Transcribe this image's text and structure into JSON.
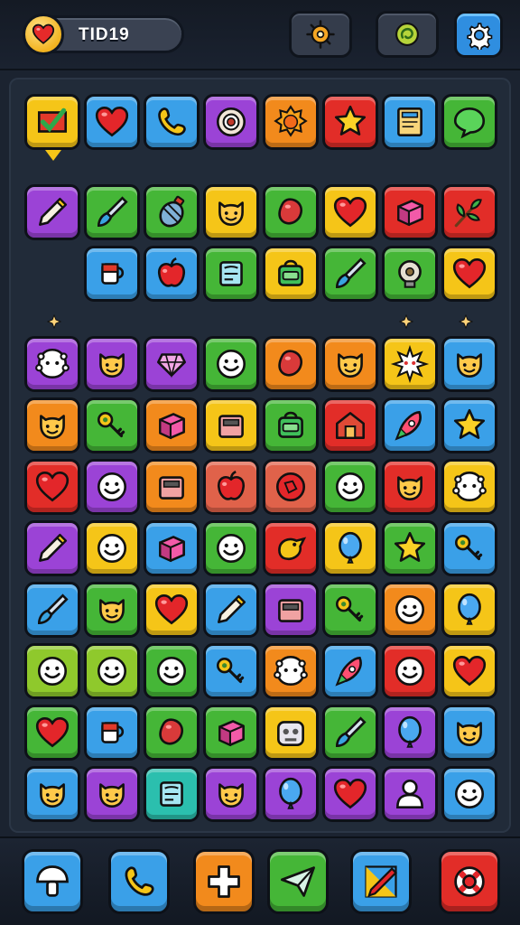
{
  "header": {
    "lives_value": "TID19",
    "buttons": [
      {
        "name": "daily-bonus-button",
        "icon": "sun-gear-icon"
      },
      {
        "name": "hint-button",
        "icon": "swirl-icon"
      },
      {
        "name": "settings-button",
        "icon": "gear-icon"
      }
    ]
  },
  "palette": {
    "yellow": "#f5c518",
    "blue": "#3aa0e8",
    "purple": "#9b43d6",
    "orange": "#f28a1c",
    "red": "#e22d28",
    "green": "#45b637",
    "lime": "#8fc92c",
    "teal": "#2bbfae",
    "salmon": "#e0624a",
    "icon_dark": "#1a1a1a"
  },
  "board": {
    "top_row": [
      {
        "color": "yellow",
        "icon": "check-flag-icon"
      },
      {
        "color": "blue",
        "icon": "heart-icon"
      },
      {
        "color": "blue",
        "icon": "phone-icon"
      },
      {
        "color": "purple",
        "icon": "target-icon"
      },
      {
        "color": "orange",
        "icon": "sun-icon"
      },
      {
        "color": "red",
        "icon": "star-icon"
      },
      {
        "color": "blue",
        "icon": "book-icon"
      },
      {
        "color": "green",
        "icon": "speech-bubble-icon"
      }
    ],
    "row_two": [
      {
        "color": "purple",
        "icon": "pencil-icon"
      },
      {
        "color": "green",
        "icon": "brush-icon"
      },
      {
        "color": "green",
        "icon": "grenade-icon"
      },
      {
        "color": "yellow",
        "icon": "cat-face-icon"
      },
      {
        "color": "green",
        "icon": "bean-icon"
      },
      {
        "color": "yellow",
        "icon": "heart-icon"
      },
      {
        "color": "red",
        "icon": "cube-icon"
      },
      {
        "color": "red",
        "icon": "leaf-branch-icon"
      }
    ],
    "row_three": [
      {
        "color": "blue",
        "icon": "mug-icon"
      },
      {
        "color": "blue",
        "icon": "apple-icon"
      },
      {
        "color": "green",
        "icon": "scroll-icon"
      },
      {
        "color": "yellow",
        "icon": "bag-icon"
      },
      {
        "color": "green",
        "icon": "brush-icon"
      },
      {
        "color": "green",
        "icon": "bulb-icon"
      },
      {
        "color": "yellow",
        "icon": "heart-icon"
      }
    ],
    "grid": [
      [
        {
          "color": "purple",
          "icon": "ghost-icon"
        },
        {
          "color": "purple",
          "icon": "cat-face-icon"
        },
        {
          "color": "purple",
          "icon": "gem-icon"
        },
        {
          "color": "green",
          "icon": "smiley-icon"
        },
        {
          "color": "orange",
          "icon": "bean-icon"
        },
        {
          "color": "orange",
          "icon": "cat-face-icon"
        },
        {
          "color": "yellow",
          "icon": "burst-icon"
        },
        {
          "color": "blue",
          "icon": "cat-face-icon"
        }
      ],
      [
        {
          "color": "orange",
          "icon": "cat-face-icon"
        },
        {
          "color": "green",
          "icon": "key-icon"
        },
        {
          "color": "orange",
          "icon": "cube-icon"
        },
        {
          "color": "yellow",
          "icon": "box-icon"
        },
        {
          "color": "green",
          "icon": "bag-icon"
        },
        {
          "color": "red",
          "icon": "house-icon"
        },
        {
          "color": "blue",
          "icon": "rocket-icon"
        },
        {
          "color": "blue",
          "icon": "star-icon"
        }
      ],
      [
        {
          "color": "red",
          "icon": "heart-icon"
        },
        {
          "color": "purple",
          "icon": "smiley-icon"
        },
        {
          "color": "orange",
          "icon": "box-icon"
        },
        {
          "color": "salmon",
          "icon": "apple-icon"
        },
        {
          "color": "salmon",
          "icon": "ball-icon"
        },
        {
          "color": "green",
          "icon": "smiley-icon"
        },
        {
          "color": "red",
          "icon": "cat-face-icon"
        },
        {
          "color": "yellow",
          "icon": "ghost-icon"
        }
      ],
      [
        {
          "color": "purple",
          "icon": "pencil-icon"
        },
        {
          "color": "yellow",
          "icon": "smiley-icon"
        },
        {
          "color": "blue",
          "icon": "cube-icon"
        },
        {
          "color": "green",
          "icon": "smiley-icon"
        },
        {
          "color": "red",
          "icon": "bird-icon"
        },
        {
          "color": "yellow",
          "icon": "balloon-icon"
        },
        {
          "color": "green",
          "icon": "star-icon"
        },
        {
          "color": "blue",
          "icon": "key-icon"
        }
      ],
      [
        {
          "color": "blue",
          "icon": "brush-icon"
        },
        {
          "color": "green",
          "icon": "cat-face-icon"
        },
        {
          "color": "yellow",
          "icon": "heart-icon"
        },
        {
          "color": "blue",
          "icon": "pencil-icon"
        },
        {
          "color": "purple",
          "icon": "box-icon"
        },
        {
          "color": "green",
          "icon": "key-icon"
        },
        {
          "color": "orange",
          "icon": "smiley-icon"
        },
        {
          "color": "yellow",
          "icon": "balloon-icon"
        }
      ],
      [
        {
          "color": "lime",
          "icon": "smiley-icon"
        },
        {
          "color": "lime",
          "icon": "smiley-icon"
        },
        {
          "color": "green",
          "icon": "smiley-icon"
        },
        {
          "color": "blue",
          "icon": "key-icon"
        },
        {
          "color": "orange",
          "icon": "ghost-icon"
        },
        {
          "color": "blue",
          "icon": "rocket-icon"
        },
        {
          "color": "red",
          "icon": "smiley-icon"
        },
        {
          "color": "yellow",
          "icon": "heart-icon"
        }
      ],
      [
        {
          "color": "green",
          "icon": "heart-icon"
        },
        {
          "color": "blue",
          "icon": "mug-icon"
        },
        {
          "color": "green",
          "icon": "bean-icon"
        },
        {
          "color": "green",
          "icon": "cube-icon"
        },
        {
          "color": "yellow",
          "icon": "robot-icon"
        },
        {
          "color": "green",
          "icon": "brush-icon"
        },
        {
          "color": "purple",
          "icon": "balloon-icon"
        },
        {
          "color": "blue",
          "icon": "cat-face-icon"
        }
      ],
      [
        {
          "color": "blue",
          "icon": "cat-face-icon"
        },
        {
          "color": "purple",
          "icon": "cat-face-icon"
        },
        {
          "color": "teal",
          "icon": "scroll-icon"
        },
        {
          "color": "purple",
          "icon": "cat-face-icon"
        },
        {
          "color": "purple",
          "icon": "balloon-icon"
        },
        {
          "color": "purple",
          "icon": "heart-icon"
        },
        {
          "color": "purple",
          "icon": "person-icon"
        },
        {
          "color": "blue",
          "icon": "smiley-icon"
        }
      ]
    ]
  },
  "bottom_bar": [
    {
      "name": "mushroom-button",
      "color": "blue",
      "icon": "mushroom-icon"
    },
    {
      "name": "call-button",
      "color": "blue",
      "icon": "phone-icon"
    },
    {
      "name": "add-button",
      "color": "orange",
      "icon": "plus-icon"
    },
    {
      "name": "send-button",
      "color": "green",
      "icon": "paper-plane-icon"
    },
    {
      "name": "paint-button",
      "color": "blue",
      "icon": "paint-brush-icon"
    },
    {
      "name": "lifebuoy-button",
      "color": "red",
      "icon": "lifebuoy-icon"
    }
  ]
}
